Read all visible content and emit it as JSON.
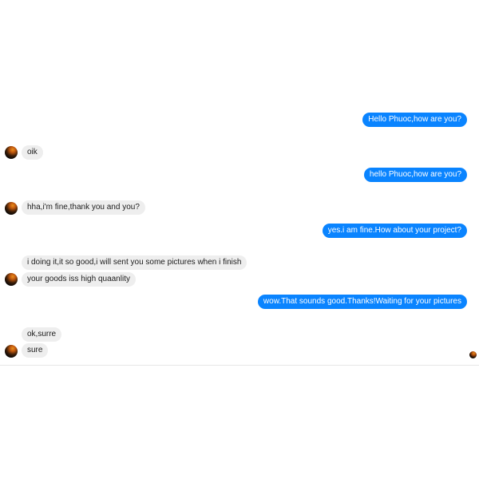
{
  "conversation": {
    "messages": [
      {
        "from": "me",
        "text": "Hello Phuoc,how are you?"
      },
      {
        "from": "them",
        "text": "oik"
      },
      {
        "from": "me",
        "text": "hello Phuoc,how are you?"
      },
      {
        "from": "them",
        "text": "hha,i'm fine,thank you and you?"
      },
      {
        "from": "me",
        "text": "yes.i am fine.How about your project?"
      },
      {
        "from": "them",
        "text": "i doing it,it so good,i will sent you some pictures when i finish"
      },
      {
        "from": "them",
        "text": "your goods iss high quaanlity"
      },
      {
        "from": "me",
        "text": "wow.That sounds good.Thanks!Waiting for your pictures"
      },
      {
        "from": "them",
        "text": "ok,surre"
      },
      {
        "from": "them",
        "text": "sure"
      }
    ]
  },
  "colors": {
    "outgoing_bubble": "#0a84ff",
    "incoming_bubble": "#eeeeee",
    "background": "#ffffff"
  },
  "icons": {
    "contact_avatar": "contact-avatar-icon",
    "read_receipt": "seen-avatar-icon"
  }
}
